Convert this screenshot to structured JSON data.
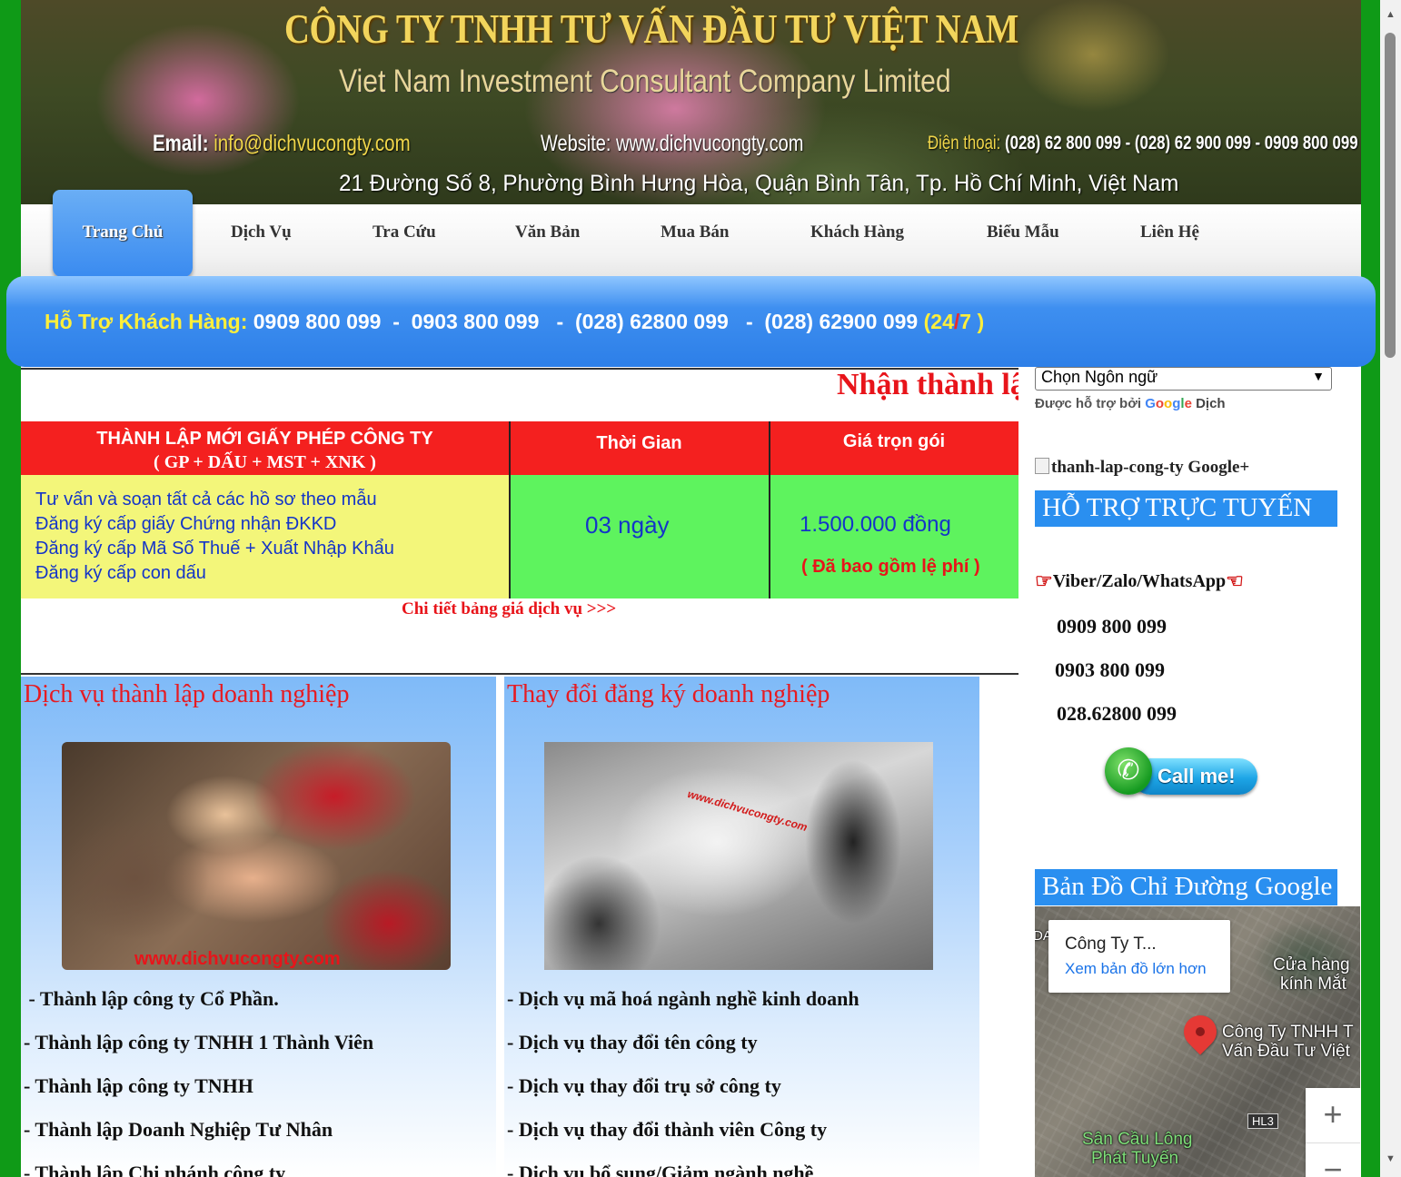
{
  "banner": {
    "title": "CÔNG TY TNHH TƯ VẤN ĐẦU TƯ VIỆT NAM",
    "subtitle": "Viet Nam Investment Consultant Company Limited",
    "email_label": "Email:",
    "email_value": "info@dichvucongty.com",
    "website": "Website: www.dichvucongty.com",
    "phone_label": "Điện thoại:",
    "phone_value": "(028) 62 800 099 - (028) 62 900 099 - 0909 800 099",
    "address": "21 Đường Số 8, Phường Bình Hưng Hòa, Quận Bình Tân, Tp. Hồ Chí Minh, Việt Nam"
  },
  "nav": {
    "items": [
      "Trang Chủ",
      "Dịch Vụ",
      "Tra Cứu",
      "Văn Bản",
      "Mua Bán",
      "Khách Hàng",
      "Biểu Mẫu",
      "Liên Hệ"
    ],
    "active": "Trang Chủ"
  },
  "support": {
    "label": "Hỗ Trợ Khách Hàng:",
    "phones": "0909 800 099  -  0903 800 099   -  (028) 62800 099   -  (028) 62900 099",
    "open": "(",
    "h24": "24",
    "slash": "/",
    "d7": "7",
    "close": ")"
  },
  "marquee": "Nhận thành lậ",
  "pricing": {
    "header_service_1": "THÀNH LẬP MỚI GIẤY PHÉP CÔNG TY",
    "header_service_2": "( GP + DẤU + MST + XNK )",
    "header_time": "Thời Gian",
    "header_price": "Giá trọn gói",
    "services": [
      "Tư vấn và soạn tất cả các hồ sơ theo mẫu",
      "Đăng ký cấp giấy Chứng nhận ĐKKD",
      "Đăng ký cấp Mã Số Thuế + Xuất Nhập Khẩu",
      "Đăng ký cấp con dấu"
    ],
    "time": "03 ngày",
    "price": "1.500.000 đồng",
    "price_note": "( Đã bao gồm lệ phí )",
    "more_link": "Chi tiết bảng giá dịch vụ >>>"
  },
  "section_left": {
    "title": "Dịch vụ thành lập doanh nghiệp",
    "image_caption": "www.dichvucongty.com",
    "items": [
      " - Thành lập công ty Cổ Phần.",
      "- Thành lập công ty TNHH 1 Thành Viên",
      "- Thành lập công ty TNHH",
      "- Thành lập Doanh Nghiệp Tư Nhân",
      "- Thành lập Chi nhánh công ty"
    ]
  },
  "section_right": {
    "title": "Thay đổi đăng ký doanh nghiệp",
    "image_caption": "www.dichvucongty.com",
    "items": [
      "- Dịch vụ mã hoá ngành nghề kinh doanh",
      "- Dịch vụ thay đổi tên công ty",
      "- Dịch vụ thay đổi trụ sở công ty",
      "- Dịch vụ thay đổi thành viên Công ty",
      "- Dịch vụ bổ sung/Giảm ngành nghề"
    ]
  },
  "sidebar": {
    "language_select": "Chọn Ngôn ngữ",
    "powered_by": "Được hỗ trợ bởi",
    "google": "Google",
    "translate": "Dịch",
    "gplus_alt": "thanh-lap-cong-ty Google+",
    "support_heading": "HỖ TRỢ TRỰC TUYẾN",
    "messaging": "Viber/Zalo/WhatsApp",
    "phones": [
      "0909 800 099",
      "0903 800 099",
      "028.62800 099"
    ],
    "call_button": "Call me!",
    "map_heading": "Bản Đồ Chỉ Đường Google"
  },
  "map": {
    "place": "Công Ty T...",
    "link": "Xem bản đồ lớn hơn",
    "label_shop_1": "Cửa hàng",
    "label_shop_2": "kính Mắt",
    "label_company_1": "Công Ty TNHH T",
    "label_company_2": "Vấn Đầu Tư Việt",
    "label_court_1": "Sân Cầu Lông",
    "label_court_2": "Phát Tuyến",
    "road": "HL3",
    "corner_text": "DA",
    "zoom_in": "+",
    "zoom_out": "−"
  },
  "colors": {
    "page_background": "#0f9a17",
    "accent_blue": "#2a8ff0",
    "accent_red": "#e8141a",
    "highlight_yellow": "#ffef3a",
    "price_green": "#5ef35e",
    "price_yellow": "#f3f67a"
  },
  "icons": [
    "phone-icon",
    "hand-pointer-icon",
    "chevron-down-icon",
    "map-pin-icon"
  ]
}
